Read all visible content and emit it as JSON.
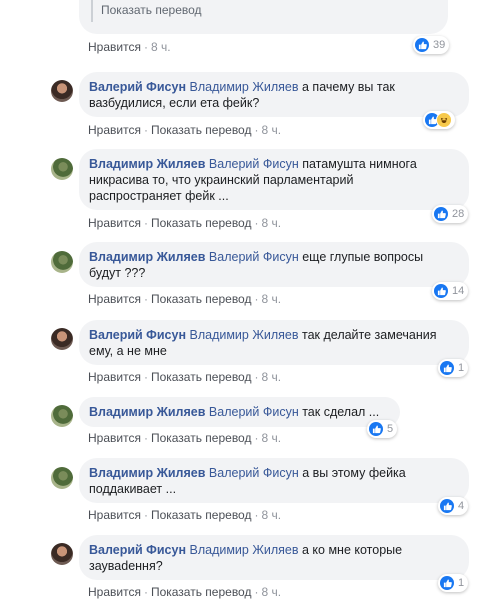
{
  "top_comment": {
    "translate_label": "Показать перевод",
    "like_label": "Нравится",
    "time": "8 ч.",
    "reaction_count": "39"
  },
  "comments": [
    {
      "author": "Валерий Фисун",
      "mention": "Владимир Жиляев",
      "text_line1": " а пачему вы так",
      "text_line2": "вазбудилися, если ета фейк?",
      "text_line3": "",
      "like_label": "Нравится",
      "translate_label": "Показать перевод",
      "time": "8 ч.",
      "reaction_count": ""
    },
    {
      "author": "Владимир Жиляев",
      "mention": "Валерий Фисун",
      "text_line1": " патамушта нимнога",
      "text_line2": "никрасива то, что украинский парламентарий",
      "text_line3": "распространяет фейк ...",
      "like_label": "Нравится",
      "translate_label": "Показать перевод",
      "time": "8 ч.",
      "reaction_count": "28"
    },
    {
      "author": "Владимир Жиляев",
      "mention": "Валерий Фисун",
      "text_line1": " еще глупые вопросы",
      "text_line2": "будут ???",
      "text_line3": "",
      "like_label": "Нравится",
      "translate_label": "Показать перевод",
      "time": "8 ч.",
      "reaction_count": "14"
    },
    {
      "author": "Валерий Фисун",
      "mention": "Владимир Жиляев",
      "text_line1": " так делайте замечания",
      "text_line2": "ему, а не мне",
      "text_line3": "",
      "like_label": "Нравится",
      "translate_label": "Показать перевод",
      "time": "8 ч.",
      "reaction_count": "1"
    },
    {
      "author": "Владимир Жиляев",
      "mention": "Валерий Фисун",
      "text_line1": " так сделал ...",
      "text_line2": "",
      "text_line3": "",
      "like_label": "Нравится",
      "translate_label": "Показать перевод",
      "time": "8 ч.",
      "reaction_count": "5"
    },
    {
      "author": "Владимир Жиляев",
      "mention": "Валерий Фисун",
      "text_line1": " а вы этому фейка",
      "text_line2": "поддакивает ...",
      "text_line3": "",
      "like_label": "Нравится",
      "translate_label": "Показать перевод",
      "time": "8 ч.",
      "reaction_count": "4"
    },
    {
      "author": "Валерий Фисун",
      "mention": "Владимир Жиляев",
      "text_line1": " а ко мне которые",
      "text_line2": "зауваdення?",
      "text_line3": "",
      "like_label": "Нравится",
      "translate_label": "Показать перевод",
      "time": "8 ч.",
      "reaction_count": "1"
    }
  ],
  "colors": {
    "link": "#385898",
    "bubble": "#f2f3f5",
    "like": "#1877f2",
    "haha": "#f7c94b"
  }
}
